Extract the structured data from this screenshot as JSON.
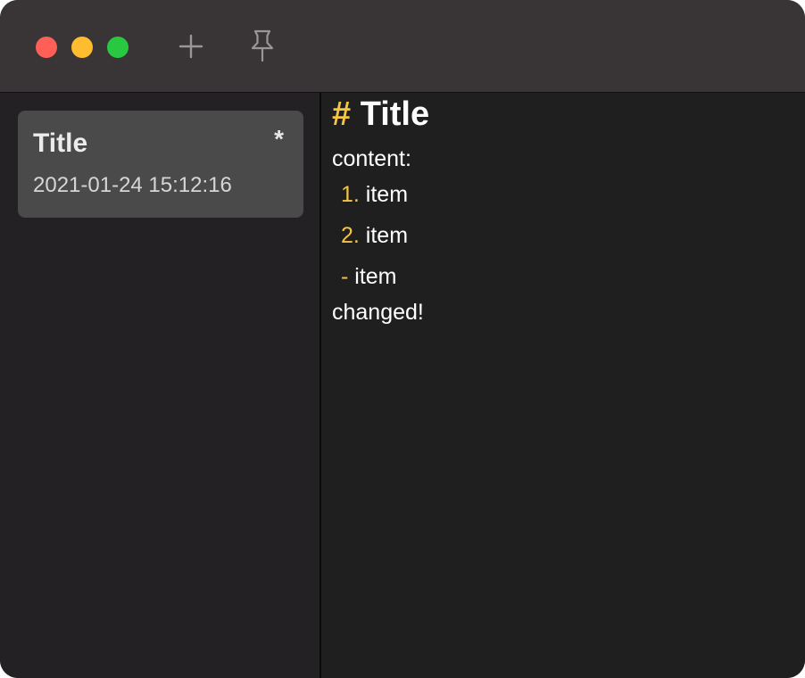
{
  "toolbar": {
    "buttons": [
      {
        "name": "close"
      },
      {
        "name": "minimize"
      },
      {
        "name": "zoom"
      }
    ],
    "add_icon": "plus-icon",
    "pin_icon": "pin-icon"
  },
  "sidebar": {
    "notes": [
      {
        "title": "Title",
        "modified_marker": "*",
        "date": "2021-01-24 15:12:16"
      }
    ]
  },
  "editor": {
    "heading_marker": "#",
    "heading_text": " Title",
    "line1": "content:",
    "list": [
      {
        "marker": "1.",
        "text": " item"
      },
      {
        "marker": "2.",
        "text": " item"
      },
      {
        "marker": "-",
        "text": " item"
      }
    ],
    "line_last": "changed!"
  },
  "colors": {
    "accent": "#f5c542",
    "window_bg": "#1f1f1f",
    "titlebar": "#393536",
    "selected_note": "#4a4a4a"
  }
}
